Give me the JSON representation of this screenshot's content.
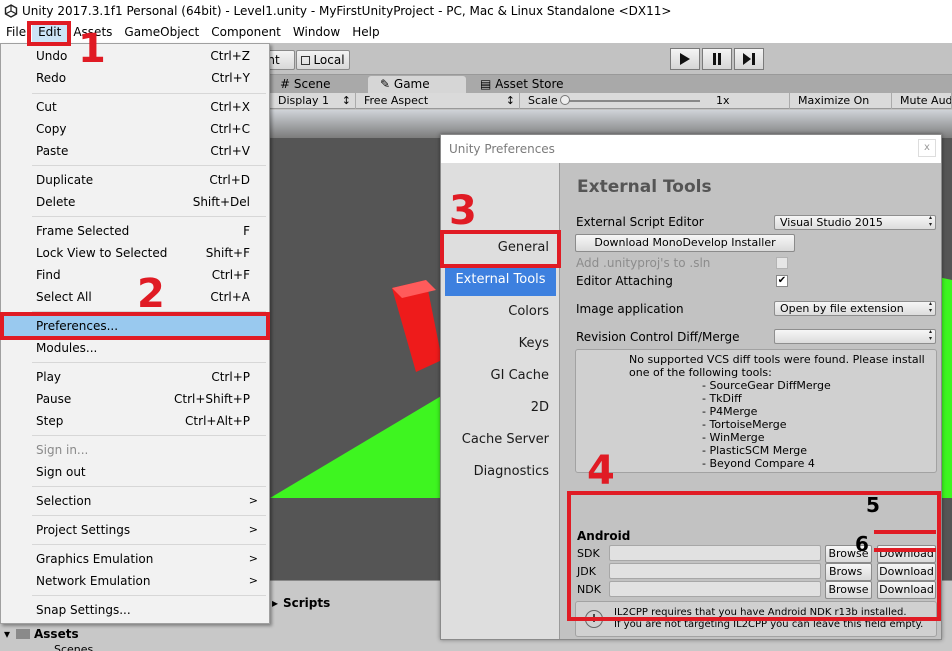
{
  "window": {
    "title": "Unity 2017.3.1f1 Personal (64bit) - Level1.unity - MyFirstUnityProject - PC, Mac & Linux Standalone <DX11>"
  },
  "menubar": [
    "File",
    "Edit",
    "Assets",
    "GameObject",
    "Component",
    "Window",
    "Help"
  ],
  "toolbar": {
    "center_label": "nt",
    "local_label": "Local"
  },
  "tabs": {
    "scene": "Scene",
    "game": "Game",
    "asset_store": "Asset Store"
  },
  "game_toolbar": {
    "display": "Display 1",
    "aspect": "Free Aspect",
    "scale_label": "Scale",
    "scale_value": "1x",
    "maximize": "Maximize On Play",
    "mute": "Mute Audio"
  },
  "edit_menu": [
    {
      "label": "Undo",
      "shortcut": "Ctrl+Z"
    },
    {
      "label": "Redo",
      "shortcut": "Ctrl+Y"
    },
    {
      "label": "Cut",
      "shortcut": "Ctrl+X"
    },
    {
      "label": "Copy",
      "shortcut": "Ctrl+C"
    },
    {
      "label": "Paste",
      "shortcut": "Ctrl+V"
    },
    {
      "label": "Duplicate",
      "shortcut": "Ctrl+D"
    },
    {
      "label": "Delete",
      "shortcut": "Shift+Del"
    },
    {
      "label": "Frame Selected",
      "shortcut": "F"
    },
    {
      "label": "Lock View to Selected",
      "shortcut": "Shift+F"
    },
    {
      "label": "Find",
      "shortcut": "Ctrl+F"
    },
    {
      "label": "Select All",
      "shortcut": "Ctrl+A"
    },
    {
      "label": "Preferences...",
      "shortcut": ""
    },
    {
      "label": "Modules...",
      "shortcut": ""
    },
    {
      "label": "Play",
      "shortcut": "Ctrl+P"
    },
    {
      "label": "Pause",
      "shortcut": "Ctrl+Shift+P"
    },
    {
      "label": "Step",
      "shortcut": "Ctrl+Alt+P"
    },
    {
      "label": "Sign in...",
      "shortcut": ""
    },
    {
      "label": "Sign out",
      "shortcut": ""
    },
    {
      "label": "Selection",
      "shortcut": ""
    },
    {
      "label": "Project Settings",
      "shortcut": ""
    },
    {
      "label": "Graphics Emulation",
      "shortcut": ""
    },
    {
      "label": "Network Emulation",
      "shortcut": ""
    },
    {
      "label": "Snap Settings...",
      "shortcut": ""
    }
  ],
  "submenu_arrow": ">",
  "bottom": {
    "scripts": "Scripts",
    "assets": "Assets",
    "scenes": "Scenes"
  },
  "preferences": {
    "title": "Unity Preferences",
    "close": "x",
    "sidebar": [
      "General",
      "External Tools",
      "Colors",
      "Keys",
      "GI Cache",
      "2D",
      "Cache Server",
      "Diagnostics"
    ],
    "section_title": "External Tools",
    "external_script_editor_label": "External Script Editor",
    "external_script_editor_value": "Visual Studio 2015",
    "download_monodevelop": "Download MonoDevelop Installer",
    "add_unityproj_label": "Add .unityproj's to .sln",
    "editor_attaching_label": "Editor Attaching",
    "image_application_label": "Image application",
    "image_application_value": "Open by file extension",
    "revision_control_label": "Revision Control Diff/Merge",
    "revision_control_value": "",
    "vcs_message": "No supported VCS diff tools were found. Please install one of the following tools:",
    "vcs_tools": [
      "- SourceGear DiffMerge",
      "- TkDiff",
      "- P4Merge",
      "- TortoiseMerge",
      "- WinMerge",
      "- PlasticSCM Merge",
      "- Beyond Compare 4"
    ],
    "android_title": "Android",
    "android_rows": [
      {
        "label": "SDK",
        "browse": "Browse",
        "download": "Download"
      },
      {
        "label": "JDK",
        "browse": "Brows",
        "download": "Download"
      },
      {
        "label": "NDK",
        "browse": "Browse",
        "download": "Download"
      }
    ],
    "il2cpp_line1": "IL2CPP requires that you have Android NDK r13b installed.",
    "il2cpp_line2": "If you are not targeting IL2CPP you can leave this field empty."
  },
  "annotations": [
    "1",
    "2",
    "3",
    "4",
    "5",
    "6"
  ],
  "colors": {
    "annotation_red": "#e01b24",
    "selection_blue": "#3d80df",
    "menu_highlight": "#99c9ef",
    "ground_green": "#3ef520",
    "cube_red": "#ee1b1b"
  }
}
